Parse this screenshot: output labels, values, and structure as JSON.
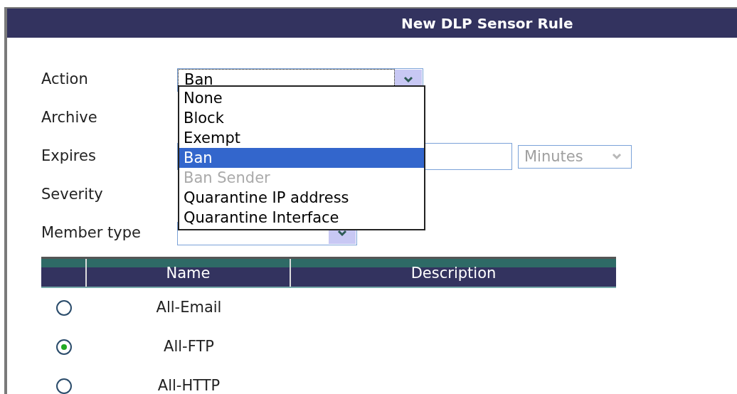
{
  "window": {
    "title": "New DLP Sensor Rule"
  },
  "form": {
    "fields": [
      {
        "label": "Action",
        "kind": "select",
        "value": "Ban"
      },
      {
        "label": "Archive",
        "kind": "hidden"
      },
      {
        "label": "Expires",
        "kind": "expires",
        "unit": "Minutes",
        "unit_disabled": true
      },
      {
        "label": "Severity",
        "kind": "hidden"
      },
      {
        "label": "Member type",
        "kind": "select"
      }
    ]
  },
  "dropdown": {
    "options": [
      {
        "label": "None",
        "selected": false,
        "disabled": false
      },
      {
        "label": "Block",
        "selected": false,
        "disabled": false
      },
      {
        "label": "Exempt",
        "selected": false,
        "disabled": false
      },
      {
        "label": "Ban",
        "selected": true,
        "disabled": false
      },
      {
        "label": "Ban Sender",
        "selected": false,
        "disabled": true
      },
      {
        "label": "Quarantine IP address",
        "selected": false,
        "disabled": false
      },
      {
        "label": "Quarantine Interface",
        "selected": false,
        "disabled": false
      }
    ]
  },
  "table": {
    "columns": [
      "Name",
      "Description"
    ],
    "rows": [
      {
        "name": "All-Email",
        "selected": false
      },
      {
        "name": "All-FTP",
        "selected": true
      },
      {
        "name": "All-HTTP",
        "selected": false
      }
    ]
  }
}
